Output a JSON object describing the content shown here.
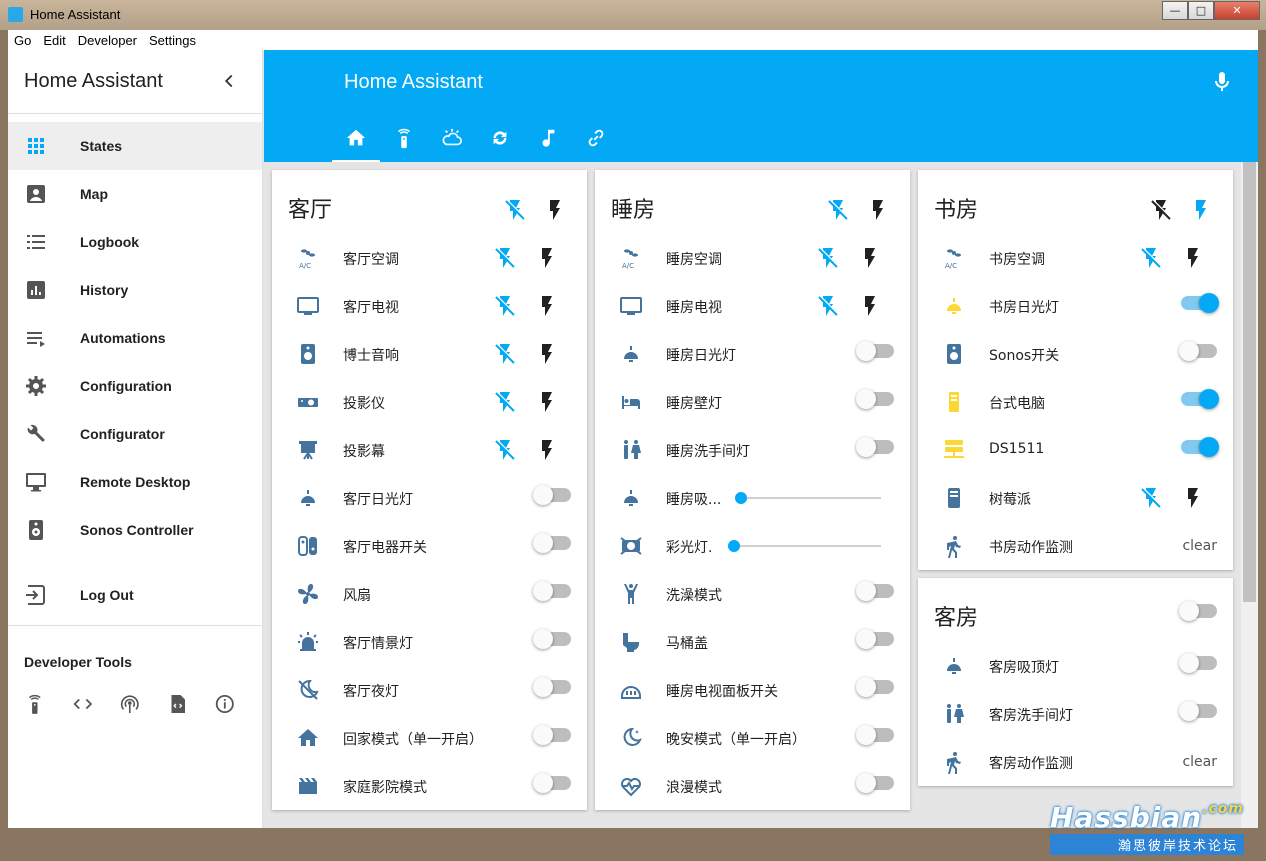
{
  "window": {
    "title": "Home Assistant",
    "min": "—",
    "max": "□",
    "close": "✕"
  },
  "menu": [
    "Go",
    "Edit",
    "Developer",
    "Settings"
  ],
  "sidebar": {
    "title": "Home Assistant",
    "items": [
      {
        "label": "States",
        "icon": "grid-icon",
        "active": true
      },
      {
        "label": "Map",
        "icon": "map-icon"
      },
      {
        "label": "Logbook",
        "icon": "list-icon"
      },
      {
        "label": "History",
        "icon": "chart-icon"
      },
      {
        "label": "Automations",
        "icon": "playlist-icon"
      },
      {
        "label": "Configuration",
        "icon": "gear-icon"
      },
      {
        "label": "Configurator",
        "icon": "wrench-icon"
      },
      {
        "label": "Remote Desktop",
        "icon": "monitor-icon"
      },
      {
        "label": "Sonos Controller",
        "icon": "speaker-icon"
      }
    ],
    "logout": "Log Out",
    "dev_title": "Developer Tools"
  },
  "header": {
    "title": "Home Assistant"
  },
  "tabs": [
    "home-icon",
    "remote-icon",
    "weather-icon",
    "sync-icon",
    "music-icon",
    "link-icon"
  ],
  "cards": {
    "living": {
      "title": "客厅",
      "rows": [
        "客厅空调",
        "客厅电视",
        "博士音响",
        "投影仪",
        "投影幕",
        "客厅日光灯",
        "客厅电器开关",
        "风扇",
        "客厅情景灯",
        "客厅夜灯",
        "回家模式（单一开启）",
        "家庭影院模式"
      ]
    },
    "bedroom": {
      "title": "睡房",
      "rows": [
        "睡房空调",
        "睡房电视",
        "睡房日光灯",
        "睡房壁灯",
        "睡房洗手间灯",
        "睡房吸...",
        "彩光灯.",
        "洗澡模式",
        "马桶盖",
        "睡房电视面板开关",
        "晚安模式（单一开启）",
        "浪漫模式"
      ]
    },
    "study": {
      "title": "书房",
      "rows": [
        "书房空调",
        "书房日光灯",
        "Sonos开关",
        "台式电脑",
        "DS1511",
        "树莓派",
        "书房动作监测"
      ],
      "clear": "clear"
    },
    "guest": {
      "title": "客房",
      "rows": [
        "客房吸顶灯",
        "客房洗手间灯",
        "客房动作监测"
      ],
      "clear": "clear"
    }
  },
  "levels": {
    "bedroom_ceiling": 0,
    "color_light": 0
  },
  "colors": {
    "accent": "#03a9f4",
    "icon": "#44739e",
    "active_yellow": "#fdd835"
  },
  "watermark": {
    "brand": "Hassbian",
    "dotcom": ".com",
    "tagline": "瀚思彼岸技术论坛"
  }
}
